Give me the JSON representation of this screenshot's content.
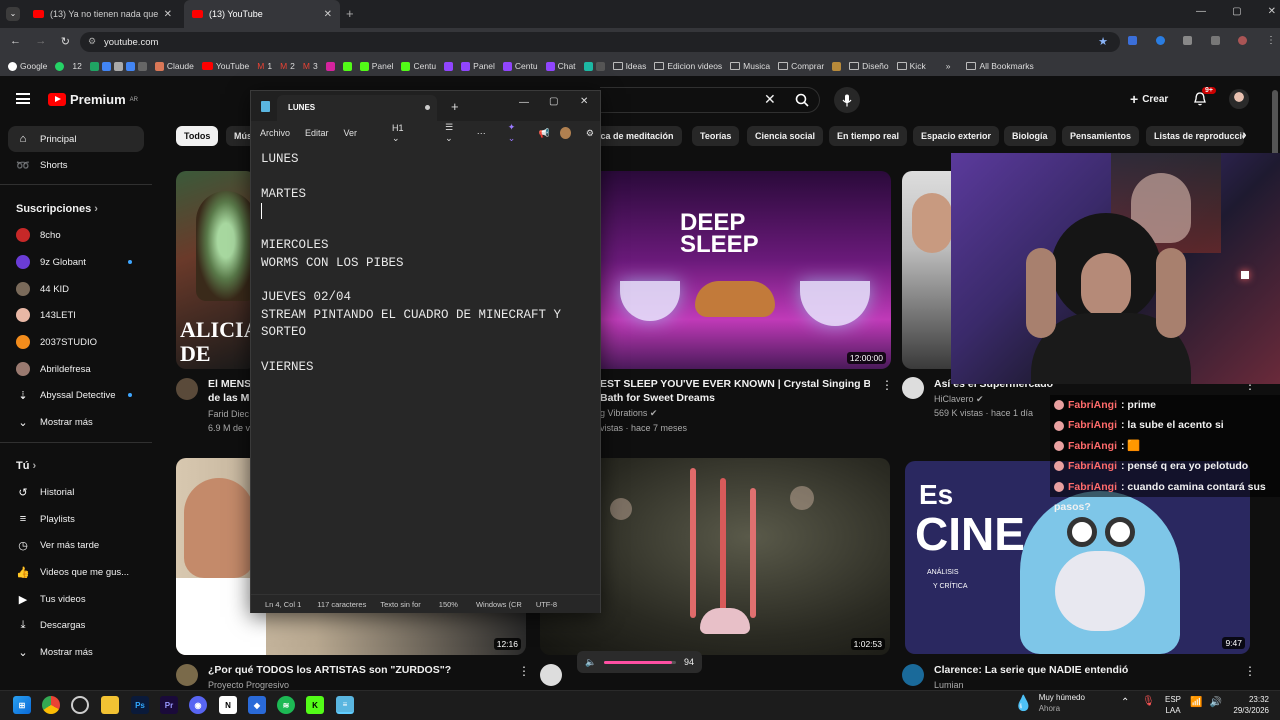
{
  "browser": {
    "tabs": [
      {
        "label": "(13) Ya no tienen nada que dec"
      },
      {
        "label": "(13) YouTube"
      }
    ],
    "url": "youtube.com",
    "bookmarks": [
      "Google",
      "12",
      "Claude",
      "YouTube",
      "1",
      "2",
      "3",
      "Panel",
      "Centu",
      "Panel",
      "Centu",
      "Chat",
      "Ideas",
      "Edicion videos",
      "Musica",
      "Comprar",
      "Diseño",
      "Kick"
    ],
    "all_bookmarks": "All Bookmarks"
  },
  "youtube": {
    "logo": "Premium",
    "logo_region": "AR",
    "create_label": "Crear",
    "notif_badge": "9+",
    "sidebar": {
      "main": [
        {
          "label": "Principal"
        },
        {
          "label": "Shorts"
        }
      ],
      "subs_header": "Suscripciones",
      "subs": [
        {
          "label": "8cho"
        },
        {
          "label": "9z Globant"
        },
        {
          "label": "44 KID"
        },
        {
          "label": "143LETI"
        },
        {
          "label": "2037STUDIO"
        },
        {
          "label": "Abrildefresa"
        },
        {
          "label": "Abyssal Detective"
        },
        {
          "label": "Mostrar más"
        }
      ],
      "you_header": "Tú",
      "you": [
        {
          "label": "Historial"
        },
        {
          "label": "Playlists"
        },
        {
          "label": "Ver más tarde"
        },
        {
          "label": "Videos que me gus..."
        },
        {
          "label": "Tus videos"
        },
        {
          "label": "Descargas"
        },
        {
          "label": "Mostrar más"
        }
      ]
    },
    "chips": [
      "Todos",
      "Mús",
      "ica de meditación",
      "Teorías",
      "Ciencia social",
      "En tiempo real",
      "Espacio exterior",
      "Biología",
      "Pensamientos",
      "Listas de reproducció"
    ],
    "videos": [
      {
        "title": "El MENS",
        "title2": "de las M",
        "channel": "Farid Diec",
        "meta": "6.9 M de v",
        "thumb_text": "ALICIA",
        "thumb_text2": "DE LAS"
      },
      {
        "title": "EST SLEEP YOU'VE EVER KNOWN | Crystal Singing Bowl",
        "title2": "Bath for Sweet Dreams",
        "channel": "g Vibrations",
        "meta": "vistas · hace 7 meses",
        "duration": "12:00:00",
        "thumb_text": "DEEP",
        "thumb_text2": "SLEEP"
      },
      {
        "title": "Así es el Supermercado más",
        "title2": "",
        "channel": "HiClavero",
        "meta": "569 K vistas · hace 1 día"
      },
      {
        "title": "¿Por qué TODOS los ARTISTAS son \"ZURDOS\"?",
        "channel": "Proyecto Progresivo",
        "duration": "12:16"
      },
      {
        "title": "",
        "duration": "1:02:53"
      },
      {
        "title": "Clarence: La serie que NADIE entendió",
        "channel": "Lumian",
        "duration": "9:47",
        "thumb_text": "Es",
        "thumb_text2": "CINE",
        "thumb_text3": "ANÁLISIS",
        "thumb_text4": "Y CRÍTICA"
      }
    ]
  },
  "notepad": {
    "tab_title": "LUNES",
    "menu": [
      "Archivo",
      "Editar",
      "Ver"
    ],
    "heading": "H1",
    "lines": [
      "LUNES",
      "",
      "MARTES",
      "",
      "",
      "MIERCOLES",
      "WORMS CON LOS PIBES",
      "",
      "JUEVES 02/04",
      "STREAM PINTANDO EL CUADRO DE MINECRAFT Y",
      "SORTEO",
      "",
      "VIERNES"
    ],
    "status": {
      "position": "Ln 4, Col 1",
      "chars": "117 caracteres",
      "format": "Texto sin for",
      "zoom": "150%",
      "eol": "Windows (CR",
      "encoding": "UTF-8"
    }
  },
  "chat": [
    {
      "user": "FabriAngi",
      "msg": ": prime"
    },
    {
      "user": "FabriAngi",
      "msg": ": la sube el acento si"
    },
    {
      "user": "FabriAngi",
      "msg": ": 🟧"
    },
    {
      "user": "FabriAngi",
      "msg": ": pensé q era yo pelotudo"
    },
    {
      "user": "FabriAngi",
      "msg": ": cuando camina contará sus"
    },
    {
      "user": "",
      "msg": "pasos?"
    }
  ],
  "volume": {
    "value": "94",
    "level": 0.94
  },
  "taskbar": {
    "weather_title": "Muy húmedo",
    "weather_sub": "Ahora",
    "lang": "ESP",
    "lang2": "LAA",
    "time": "23:32",
    "date": "29/3/2026"
  },
  "colors": {
    "yt_red": "#ff0000",
    "chat_name": "#ff6b6b",
    "accent_blue": "#3ea6ff"
  }
}
